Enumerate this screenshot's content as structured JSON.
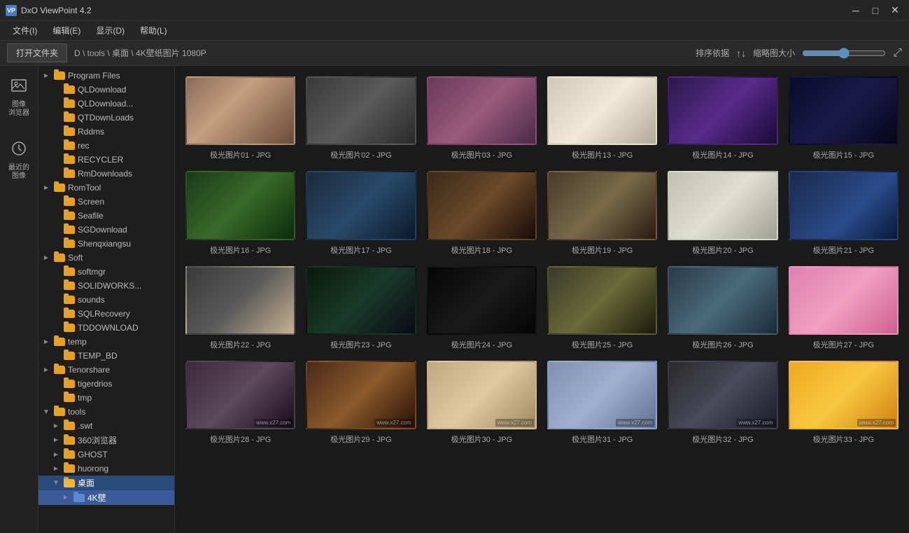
{
  "titleBar": {
    "icon": "VP",
    "title": "DxO ViewPoint 4.2",
    "minBtn": "─",
    "maxBtn": "□",
    "closeBtn": "✕"
  },
  "menuBar": {
    "items": [
      {
        "label": "文件(I)"
      },
      {
        "label": "编辑(E)"
      },
      {
        "label": "显示(D)"
      },
      {
        "label": "帮助(L)"
      }
    ]
  },
  "toolbar": {
    "openFolderBtn": "打开文件夹",
    "path": "D \\ tools \\ 桌面 \\ 4K壁纸图片 1080P",
    "sortLabel": "排序依据",
    "thumbLabel": "缩略图大小"
  },
  "sidebar": {
    "icons": [
      {
        "name": "image-browser-icon",
        "symbol": "🖼",
        "label": "图像\n浏览器"
      },
      {
        "name": "recent-images-icon",
        "symbol": "⏱",
        "label": "最近的\n图像"
      }
    ]
  },
  "fileTree": {
    "items": [
      {
        "id": "program-files",
        "label": "Program Files",
        "indent": 1,
        "expanded": false,
        "hasExpand": true
      },
      {
        "id": "qldownload",
        "label": "QLDownload",
        "indent": 2,
        "expanded": false,
        "hasExpand": false
      },
      {
        "id": "qldownload2",
        "label": "QLDownload...",
        "indent": 2,
        "expanded": false,
        "hasExpand": false
      },
      {
        "id": "qtdownloads",
        "label": "QTDownLoads",
        "indent": 2,
        "expanded": false,
        "hasExpand": false
      },
      {
        "id": "rddms",
        "label": "Rddms",
        "indent": 2,
        "expanded": false,
        "hasExpand": false
      },
      {
        "id": "rec",
        "label": "rec",
        "indent": 2,
        "expanded": false,
        "hasExpand": false
      },
      {
        "id": "recycler",
        "label": "RECYCLER",
        "indent": 2,
        "expanded": false,
        "hasExpand": false
      },
      {
        "id": "rmdownloads",
        "label": "RmDownloads",
        "indent": 2,
        "expanded": false,
        "hasExpand": false
      },
      {
        "id": "romtool",
        "label": "RomTool",
        "indent": 1,
        "expanded": false,
        "hasExpand": true
      },
      {
        "id": "screen",
        "label": "Screen",
        "indent": 2,
        "expanded": false,
        "hasExpand": false
      },
      {
        "id": "seafile",
        "label": "Seafile",
        "indent": 2,
        "expanded": false,
        "hasExpand": false
      },
      {
        "id": "sgdownload",
        "label": "SGDownload",
        "indent": 2,
        "expanded": false,
        "hasExpand": false
      },
      {
        "id": "shenqxiangsu",
        "label": "Shenqxiangsu",
        "indent": 2,
        "expanded": false,
        "hasExpand": false
      },
      {
        "id": "soft",
        "label": "Soft",
        "indent": 1,
        "expanded": false,
        "hasExpand": true
      },
      {
        "id": "softmgr",
        "label": "softmgr",
        "indent": 2,
        "expanded": false,
        "hasExpand": false
      },
      {
        "id": "solidworks",
        "label": "SOLIDWORKS...",
        "indent": 2,
        "expanded": false,
        "hasExpand": false
      },
      {
        "id": "sounds",
        "label": "sounds",
        "indent": 2,
        "expanded": false,
        "hasExpand": false
      },
      {
        "id": "sqlrecovery",
        "label": "SQLRecovery",
        "indent": 2,
        "expanded": false,
        "hasExpand": false
      },
      {
        "id": "tddownload",
        "label": "TDDOWNLOAD",
        "indent": 2,
        "expanded": false,
        "hasExpand": false
      },
      {
        "id": "temp",
        "label": "temp",
        "indent": 1,
        "expanded": false,
        "hasExpand": true
      },
      {
        "id": "temp-bd",
        "label": "TEMP_BD",
        "indent": 2,
        "expanded": false,
        "hasExpand": false
      },
      {
        "id": "tenorshare",
        "label": "Tenorshare",
        "indent": 1,
        "expanded": false,
        "hasExpand": true
      },
      {
        "id": "tigerdrios",
        "label": "tigerdrios",
        "indent": 2,
        "expanded": false,
        "hasExpand": false
      },
      {
        "id": "tmp",
        "label": "tmp",
        "indent": 2,
        "expanded": false,
        "hasExpand": false
      },
      {
        "id": "tools",
        "label": "tools",
        "indent": 1,
        "expanded": true,
        "hasExpand": true
      },
      {
        "id": "swt",
        "label": ".swt",
        "indent": 2,
        "expanded": false,
        "hasExpand": true
      },
      {
        "id": "browser360",
        "label": "360浏览器",
        "indent": 2,
        "expanded": false,
        "hasExpand": true
      },
      {
        "id": "ghost",
        "label": "GHOST",
        "indent": 2,
        "expanded": false,
        "hasExpand": true
      },
      {
        "id": "huorong",
        "label": "huorong",
        "indent": 2,
        "expanded": false,
        "hasExpand": true
      },
      {
        "id": "desktop",
        "label": "桌面",
        "indent": 2,
        "expanded": true,
        "hasExpand": true,
        "selected": true
      },
      {
        "id": "4k-wallpaper",
        "label": "4K壁",
        "indent": 3,
        "expanded": false,
        "hasExpand": true,
        "highlighted": true
      }
    ]
  },
  "images": [
    {
      "id": "img01",
      "label": "极光图片01 - JPG",
      "thumb": "thumb-01"
    },
    {
      "id": "img02",
      "label": "极光图片02 - JPG",
      "thumb": "thumb-02"
    },
    {
      "id": "img03",
      "label": "极光图片03 - JPG",
      "thumb": "thumb-03"
    },
    {
      "id": "img13",
      "label": "极光图片13 - JPG",
      "thumb": "thumb-13"
    },
    {
      "id": "img14",
      "label": "极光图片14 - JPG",
      "thumb": "thumb-14"
    },
    {
      "id": "img15",
      "label": "极光图片15 - JPG",
      "thumb": "thumb-15"
    },
    {
      "id": "img16",
      "label": "极光图片16 - JPG",
      "thumb": "thumb-16"
    },
    {
      "id": "img17",
      "label": "极光图片17 - JPG",
      "thumb": "thumb-17"
    },
    {
      "id": "img18",
      "label": "极光图片18 - JPG",
      "thumb": "thumb-18"
    },
    {
      "id": "img19",
      "label": "极光图片19 - JPG",
      "thumb": "thumb-19"
    },
    {
      "id": "img20",
      "label": "极光图片20 - JPG",
      "thumb": "thumb-20"
    },
    {
      "id": "img21",
      "label": "极光图片21 - JPG",
      "thumb": "thumb-21"
    },
    {
      "id": "img22",
      "label": "极光图片22 - JPG",
      "thumb": "thumb-22"
    },
    {
      "id": "img23",
      "label": "极光图片23 - JPG",
      "thumb": "thumb-23"
    },
    {
      "id": "img24",
      "label": "极光图片24 - JPG",
      "thumb": "thumb-24"
    },
    {
      "id": "img25",
      "label": "极光图片25 - JPG",
      "thumb": "thumb-25"
    },
    {
      "id": "img26",
      "label": "极光图片26 - JPG",
      "thumb": "thumb-26"
    },
    {
      "id": "img27",
      "label": "极光图片27 - JPG",
      "thumb": "thumb-27"
    },
    {
      "id": "img28",
      "label": "极光图片28 - JPG",
      "thumb": "thumb-28"
    },
    {
      "id": "img29",
      "label": "极光图片29 - JPG",
      "thumb": "thumb-29"
    },
    {
      "id": "img30",
      "label": "极光图片30 - JPG",
      "thumb": "thumb-30"
    },
    {
      "id": "img31",
      "label": "极光图片31 - JPG",
      "thumb": "thumb-31"
    },
    {
      "id": "img32",
      "label": "极光图片32 - JPG",
      "thumb": "thumb-32"
    },
    {
      "id": "img33",
      "label": "极光图片33 - JPG",
      "thumb": "thumb-33"
    }
  ]
}
